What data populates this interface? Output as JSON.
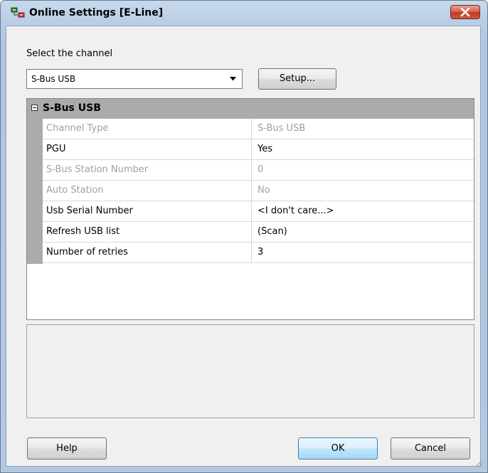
{
  "window": {
    "title": "Online Settings [E-Line]",
    "close_icon": "close-icon"
  },
  "channel": {
    "label": "Select the channel",
    "selected": "S-Bus USB",
    "setup_label": "Setup..."
  },
  "grid": {
    "category": "S-Bus USB",
    "rows": [
      {
        "name": "Channel Type",
        "value": "S-Bus USB",
        "enabled": false
      },
      {
        "name": "PGU",
        "value": "Yes",
        "enabled": true
      },
      {
        "name": "S-Bus Station Number",
        "value": "0",
        "enabled": false
      },
      {
        "name": "Auto Station",
        "value": "No",
        "enabled": false
      },
      {
        "name": "Usb Serial Number",
        "value": "<I don't care...>",
        "enabled": true
      },
      {
        "name": "Refresh USB list",
        "value": "(Scan)",
        "enabled": true
      },
      {
        "name": "Number of retries",
        "value": "3",
        "enabled": true
      }
    ]
  },
  "footer": {
    "help_label": "Help",
    "ok_label": "OK",
    "cancel_label": "Cancel"
  }
}
